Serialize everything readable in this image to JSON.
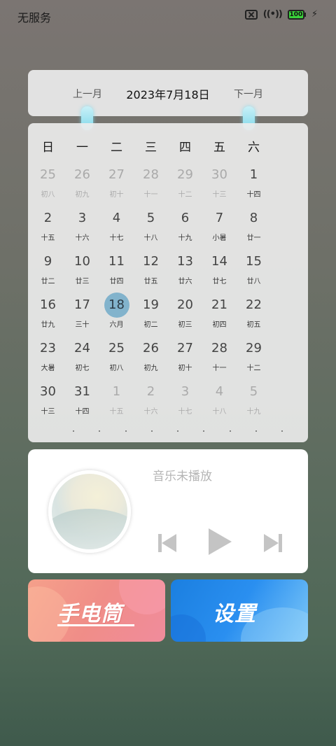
{
  "status_bar": {
    "carrier": "无服务",
    "battery": "100",
    "icons": [
      "no-sim-icon",
      "hotspot-icon",
      "battery-icon",
      "charging-icon"
    ]
  },
  "month_nav": {
    "prev_label": "上一月",
    "title": "2023年7月18日",
    "next_label": "下一月"
  },
  "calendar": {
    "weekdays": [
      "日",
      "一",
      "二",
      "三",
      "四",
      "五",
      "六"
    ],
    "today": 18,
    "weeks": [
      [
        {
          "d": "25",
          "l": "初八",
          "o": true
        },
        {
          "d": "26",
          "l": "初九",
          "o": true
        },
        {
          "d": "27",
          "l": "初十",
          "o": true
        },
        {
          "d": "28",
          "l": "十一",
          "o": true
        },
        {
          "d": "29",
          "l": "十二",
          "o": true
        },
        {
          "d": "30",
          "l": "十三",
          "o": true
        },
        {
          "d": "1",
          "l": "十四",
          "o": false
        }
      ],
      [
        {
          "d": "2",
          "l": "十五",
          "o": false
        },
        {
          "d": "3",
          "l": "十六",
          "o": false
        },
        {
          "d": "4",
          "l": "十七",
          "o": false
        },
        {
          "d": "5",
          "l": "十八",
          "o": false
        },
        {
          "d": "6",
          "l": "十九",
          "o": false
        },
        {
          "d": "7",
          "l": "小暑",
          "o": false
        },
        {
          "d": "8",
          "l": "廿一",
          "o": false
        }
      ],
      [
        {
          "d": "9",
          "l": "廿二",
          "o": false
        },
        {
          "d": "10",
          "l": "廿三",
          "o": false
        },
        {
          "d": "11",
          "l": "廿四",
          "o": false
        },
        {
          "d": "12",
          "l": "廿五",
          "o": false
        },
        {
          "d": "13",
          "l": "廿六",
          "o": false
        },
        {
          "d": "14",
          "l": "廿七",
          "o": false
        },
        {
          "d": "15",
          "l": "廿八",
          "o": false
        }
      ],
      [
        {
          "d": "16",
          "l": "廿九",
          "o": false
        },
        {
          "d": "17",
          "l": "三十",
          "o": false
        },
        {
          "d": "18",
          "l": "六月",
          "o": false,
          "today": true
        },
        {
          "d": "19",
          "l": "初二",
          "o": false
        },
        {
          "d": "20",
          "l": "初三",
          "o": false
        },
        {
          "d": "21",
          "l": "初四",
          "o": false
        },
        {
          "d": "22",
          "l": "初五",
          "o": false
        }
      ],
      [
        {
          "d": "23",
          "l": "大暑",
          "o": false
        },
        {
          "d": "24",
          "l": "初七",
          "o": false
        },
        {
          "d": "25",
          "l": "初八",
          "o": false
        },
        {
          "d": "26",
          "l": "初九",
          "o": false
        },
        {
          "d": "27",
          "l": "初十",
          "o": false
        },
        {
          "d": "28",
          "l": "十一",
          "o": false
        },
        {
          "d": "29",
          "l": "十二",
          "o": false
        }
      ],
      [
        {
          "d": "30",
          "l": "十三",
          "o": false
        },
        {
          "d": "31",
          "l": "十四",
          "o": false
        },
        {
          "d": "1",
          "l": "十五",
          "o": true
        },
        {
          "d": "2",
          "l": "十六",
          "o": true
        },
        {
          "d": "3",
          "l": "十七",
          "o": true
        },
        {
          "d": "4",
          "l": "十八",
          "o": true
        },
        {
          "d": "5",
          "l": "十九",
          "o": true
        }
      ]
    ]
  },
  "music": {
    "status": "音乐未播放",
    "controls": [
      "previous-icon",
      "play-icon",
      "next-icon"
    ]
  },
  "shortcuts": {
    "torch_label": "手电筒",
    "settings_label": "设置"
  },
  "colors": {
    "today_highlight": "#82b3cc",
    "torch_gradient": "#f08d88",
    "settings_gradient": "#2a8ff0"
  }
}
